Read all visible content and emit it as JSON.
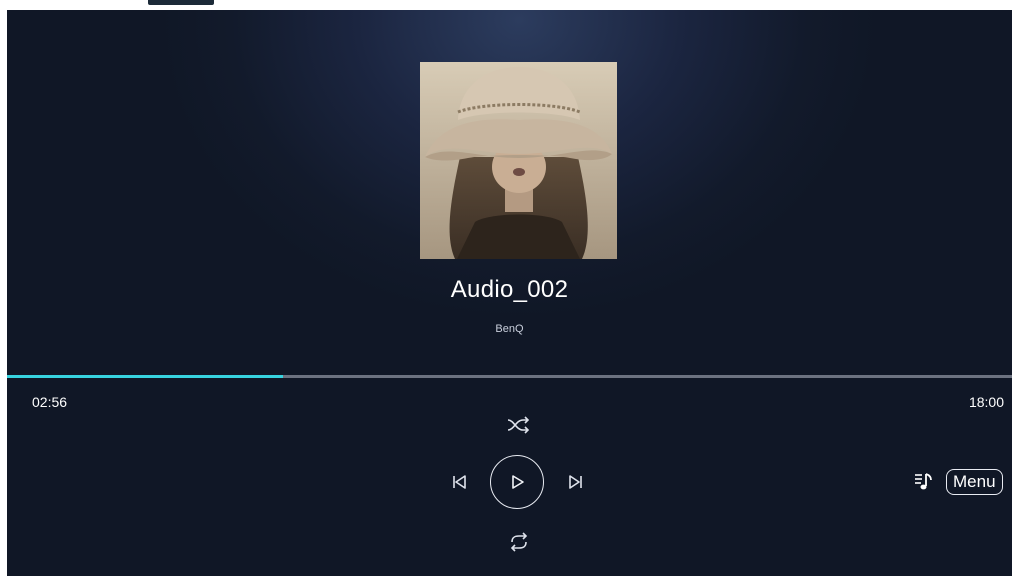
{
  "track": {
    "title": "Audio_002",
    "artist": "BenQ",
    "elapsed": "02:56",
    "duration": "18:00",
    "progress_fraction": 0.275
  },
  "controls": {
    "menu_label": "Menu",
    "icons": {
      "shuffle": "shuffle-icon",
      "previous": "skip-previous-icon",
      "play": "play-icon",
      "next": "skip-next-icon",
      "repeat": "repeat-icon",
      "playlist": "playlist-music-icon"
    }
  },
  "colors": {
    "accent": "#37d4e0",
    "background": "#121a2b",
    "text": "#ffffff"
  }
}
